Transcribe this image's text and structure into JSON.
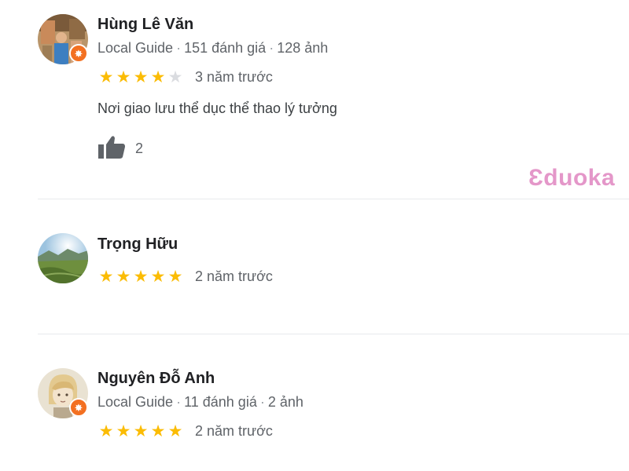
{
  "reviews": [
    {
      "name": "Hùng Lê Văn",
      "guide_label": "Local Guide",
      "review_count": "151 đánh giá",
      "photo_count": "128 ảnh",
      "rating": 4,
      "time": "3 năm trước",
      "text": "Nơi giao lưu thể dục thể thao lý tưởng",
      "likes": "2"
    },
    {
      "name": "Trọng Hữu",
      "rating": 5,
      "time": "2 năm trước"
    },
    {
      "name": "Nguyên Đỗ Anh",
      "guide_label": "Local Guide",
      "review_count": "11 đánh giá",
      "photo_count": "2 ảnh",
      "rating": 5,
      "time": "2 năm trước"
    }
  ],
  "meta_separator": "·",
  "watermark": "Ɛduoka",
  "colors": {
    "star_filled": "#fbbc04",
    "star_empty": "#dadce0",
    "guide_badge": "#f37021",
    "watermark": "#e497c9",
    "divider": "#e8eaed"
  },
  "icons": {
    "like": "thumbs-up-icon",
    "guide_badge": "local-guide-badge-icon"
  }
}
